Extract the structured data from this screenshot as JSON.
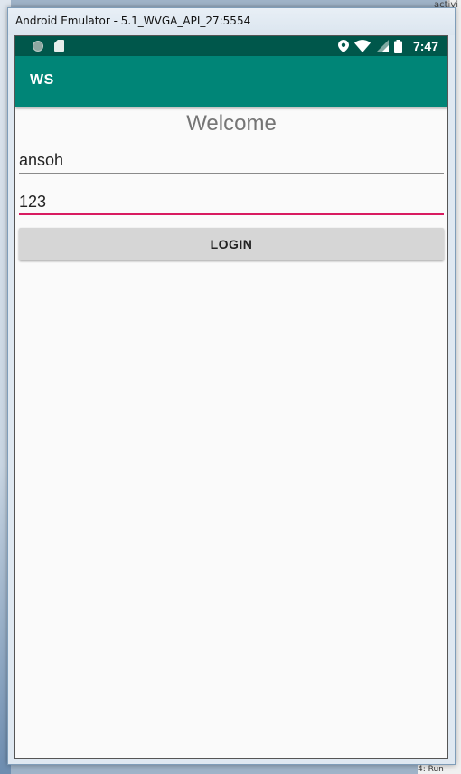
{
  "window": {
    "title": "Android Emulator - 5.1_WVGA_API_27:5554"
  },
  "background": {
    "right_top_text": "activi",
    "right_bottom_text": "4: Run"
  },
  "status_bar": {
    "time": "7:47",
    "icons": [
      "notification-dot-icon",
      "sd-card-icon",
      "location-icon",
      "wifi-icon",
      "signal-icon",
      "battery-icon"
    ]
  },
  "app_bar": {
    "title": "WS"
  },
  "main": {
    "heading": "Welcome",
    "username_value": "ansoh",
    "password_value": "123",
    "login_label": "LOGIN"
  },
  "colors": {
    "status_bar": "#00574b",
    "app_bar": "#008577",
    "accent": "#d81b60"
  }
}
